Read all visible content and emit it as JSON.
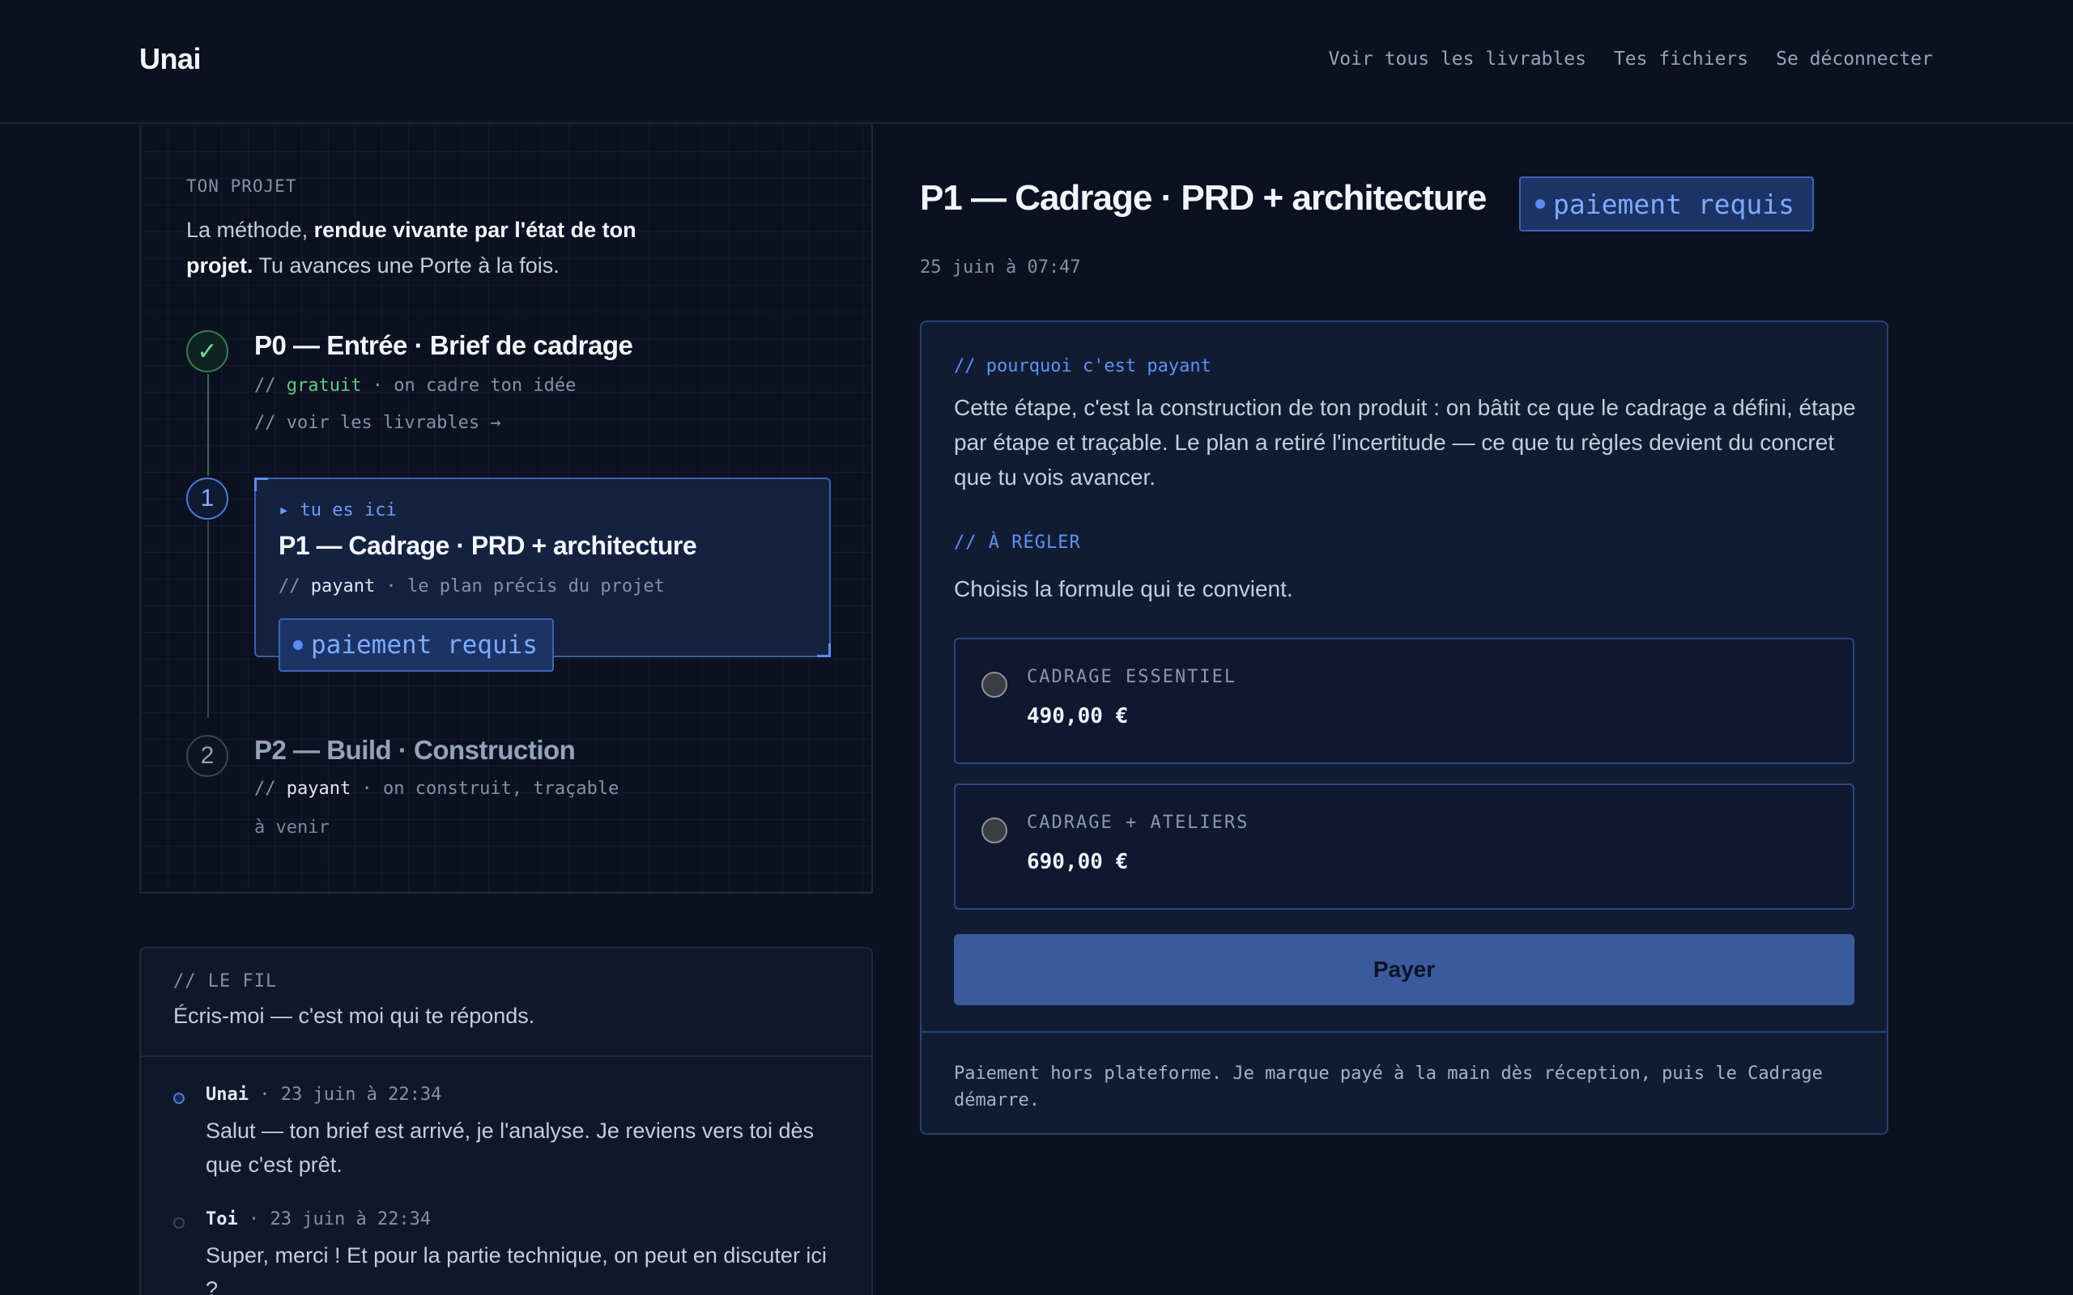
{
  "header": {
    "brand": "Unai",
    "nav": [
      "Voir tous les livrables",
      "Tes fichiers",
      "Se déconnecter"
    ]
  },
  "project": {
    "eyebrow": "TON PROJET",
    "intro_1": "La méthode, ",
    "intro_bold": "rendue vivante par l'état de ton projet.",
    "intro_2": " Tu avances une Porte à la fois.",
    "steps": [
      {
        "marker": "✓",
        "title": "P0 — Entrée · Brief de cadrage",
        "sub_prefix": "// ",
        "sub_kind": "gratuit",
        "sub_rest": " · on cadre ton idée",
        "link": "// voir les livrables →"
      },
      {
        "marker": "1",
        "here": "▸ tu es ici",
        "title": "P1 — Cadrage · PRD + architecture",
        "sub_prefix": "// ",
        "sub_kind": "payant",
        "sub_rest": " · le plan précis du projet",
        "badge": "paiement requis"
      },
      {
        "marker": "2",
        "title": "P2 — Build · Construction",
        "sub_prefix": "// ",
        "sub_kind": "payant",
        "sub_rest": " · on construit, traçable",
        "soon": "à venir"
      }
    ]
  },
  "thread": {
    "label": "// LE FIL",
    "subtitle": "Écris-moi — c'est moi qui te réponds.",
    "messages": [
      {
        "author": "Unai",
        "time": " · 23 juin à 22:34",
        "text": "Salut — ton brief est arrivé, je l'analyse. Je reviens vers toi dès que c'est prêt."
      },
      {
        "author": "Toi",
        "time": " · 23 juin à 22:34",
        "text": "Super, merci ! Et pour la partie technique, on peut en discuter ici ?"
      }
    ]
  },
  "main": {
    "title": "P1 — Cadrage · PRD + architecture",
    "badge": "paiement requis",
    "date": "25 juin à 07:47",
    "why_label": "// pourquoi c'est payant",
    "why_text": "Cette étape, c'est la construction de ton produit : on bâtit ce que le cadrage a défini, étape par étape et traçable. Le plan a retiré l'incertitude — ce que tu règles devient du concret que tu vois avancer.",
    "todo_label": "// À RÉGLER",
    "choose": "Choisis la formule qui te convient.",
    "options": [
      {
        "name": "CADRAGE ESSENTIEL",
        "price": "490,00 €"
      },
      {
        "name": "CADRAGE + ATELIERS",
        "price": "690,00 €"
      }
    ],
    "pay_label": "Payer",
    "footer": "Paiement hors plateforme. Je marque payé à la main dès réception, puis le Cadrage démarre."
  },
  "colors": {
    "background": "#0b1120",
    "accent": "#5b8cf0",
    "success": "#62c888",
    "pay_button": "#3b5a9c"
  },
  "icons": {
    "done": "check-icon",
    "badge_dot": "dot-icon",
    "option": "radio-icon"
  }
}
